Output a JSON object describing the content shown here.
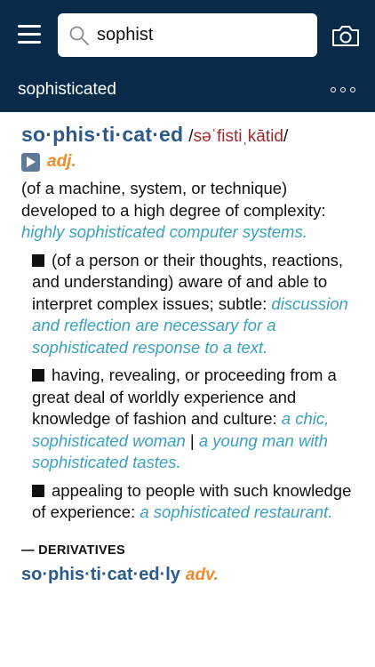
{
  "search": {
    "query": "sophist"
  },
  "subbar": {
    "title": "sophisticated"
  },
  "entry": {
    "headword": "so·phis·ti·cat·ed",
    "pron_prefix": "/",
    "pron_ipa": "səˈfistiˌkātid",
    "pron_suffix": "/",
    "pos": "adj.",
    "main_definition": "(of a machine, system, or technique) developed to a high degree of complexity:",
    "main_example": "highly sophisticated computer systems.",
    "senses": [
      {
        "definition": "(of a person or their thoughts, reactions, and understanding) aware of and able to interpret complex issues; subtle:",
        "examples": [
          "discussion and reflection are necessary for a sophisticated response to a text."
        ],
        "separator": ""
      },
      {
        "definition": "having, revealing, or proceeding from a great deal of worldly experience and knowledge of fashion and culture:",
        "examples": [
          "a chic, sophisticated woman",
          "a young man with sophisticated tastes."
        ],
        "separator": "|"
      },
      {
        "definition": "appealing to people with such knowledge of experience:",
        "examples": [
          "a sophisticated restaurant."
        ],
        "separator": ""
      }
    ],
    "derivatives_heading": "— DERIVATIVES",
    "derivative_word": "so·phis·ti·cat·ed·ly",
    "derivative_pos": "adv."
  },
  "colors": {
    "header_bg": "#0a2a4a",
    "headword": "#2a5a8f",
    "pronunciation": "#a0292a",
    "part_of_speech": "#ef8b2c",
    "example": "#3aa1bd"
  },
  "icons": [
    "menu-icon",
    "search-icon",
    "camera-icon",
    "more-icon",
    "play-icon"
  ]
}
